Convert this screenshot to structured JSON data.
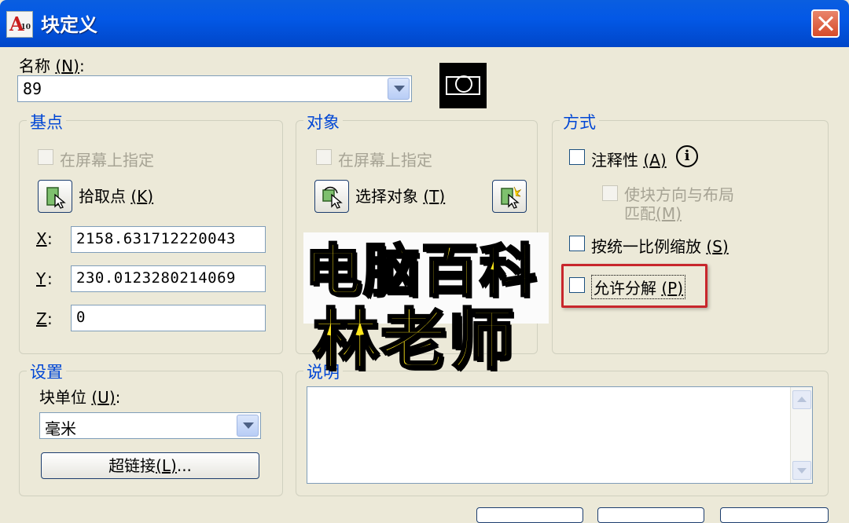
{
  "window": {
    "title": "块定义",
    "icon": "autocad-logo-icon",
    "icon_text": "A",
    "icon_sub": "10"
  },
  "name_field": {
    "label": "名称",
    "mnemonic": "N",
    "value": "89"
  },
  "base_point": {
    "title": "基点",
    "on_screen_label": "在屏幕上指定",
    "pick_label": "拾取点",
    "pick_mnemonic": "K",
    "x_label": "X",
    "x_value": "2158.631712220043",
    "y_label": "Y",
    "y_value": "230.0123280214069",
    "z_label": "Z",
    "z_value": "0"
  },
  "objects": {
    "title": "对象",
    "on_screen_label": "在屏幕上指定",
    "select_label": "选择对象",
    "select_mnemonic": "T"
  },
  "behavior": {
    "title": "方式",
    "annotative_label": "注释性",
    "annotative_mnemonic": "A",
    "match_orientation_line1": "使块方向与布局",
    "match_orientation_line2": "匹配",
    "match_orientation_mnemonic": "M",
    "uniform_scale_label": "按统一比例缩放",
    "uniform_scale_mnemonic": "S",
    "allow_explode_label": "允许分解",
    "allow_explode_mnemonic": "P"
  },
  "settings": {
    "title": "设置",
    "unit_label": "块单位",
    "unit_mnemonic": "U",
    "unit_value": "毫米",
    "hyperlink_label": "超链接",
    "hyperlink_mnemonic": "L",
    "hyperlink_suffix": "..."
  },
  "description": {
    "title": "说明"
  },
  "watermark": {
    "line1": "电脑百科",
    "line2": "林老师"
  },
  "colors": {
    "title_bar": "#0358e6",
    "group_title": "#0046d5",
    "highlight": "#c8262c",
    "watermark": "#ffe71a"
  }
}
